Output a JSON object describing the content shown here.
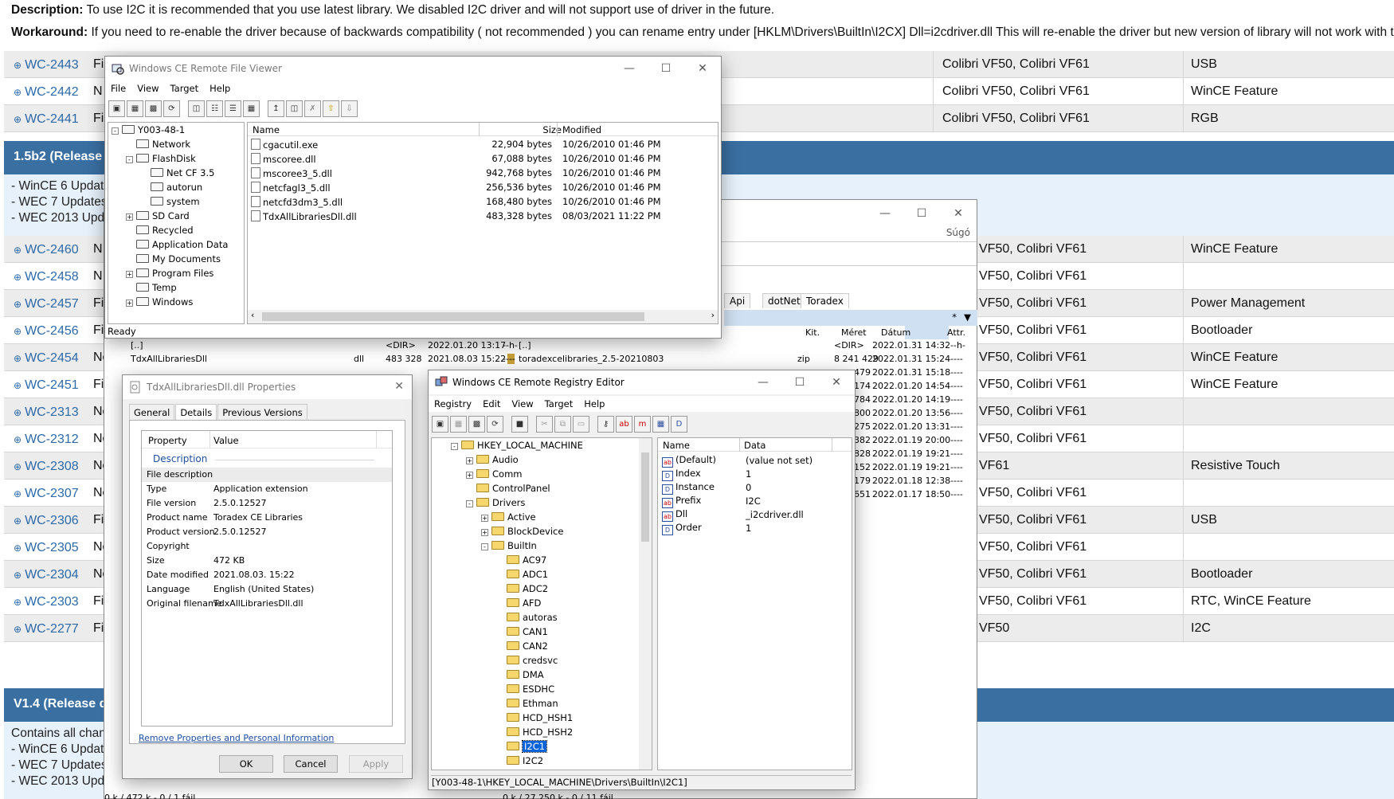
{
  "page": {
    "description_label": "Description:",
    "description_text": "To use I2C it is recommended that you use latest library. We disabled I2C driver and will not support use of driver in the future.",
    "workaround_label": "Workaround:",
    "workaround_text": "If you need to re-enable the driver because of backwards compatibility ( not recommended ) you can rename entry under [HKLM\\Drivers\\BuiltIn\\I2CX] Dll=i2cdriver.dll This will re-enable the driver but new version of library will not work with this.",
    "rows_top": [
      {
        "id": "WC-2443",
        "type": "Fi",
        "modules": "Colibri VF50, Colibri VF61",
        "component": "USB"
      },
      {
        "id": "WC-2442",
        "type": "N",
        "modules": "Colibri VF50, Colibri VF61",
        "component": "WinCE Feature"
      },
      {
        "id": "WC-2441",
        "type": "Fi",
        "modules": "Colibri VF50, Colibri VF61",
        "component": "RGB"
      }
    ],
    "release_1": "1.5b2 (Release",
    "notes_1": [
      "- WinCE 6 Update",
      "- WEC 7 Updates",
      "- WEC 2013 Upda"
    ],
    "rows_main": [
      {
        "id": "WC-2460",
        "type": "N",
        "modules": "VF50, Colibri VF61",
        "component": "WinCE Feature"
      },
      {
        "id": "WC-2458",
        "type": "N",
        "modules": "VF50, Colibri VF61",
        "component": ""
      },
      {
        "id": "WC-2457",
        "type": "Fi",
        "modules": "VF50, Colibri VF61",
        "component": "Power Management"
      },
      {
        "id": "WC-2456",
        "type": "Fix",
        "modules": "VF50, Colibri VF61",
        "component": "Bootloader"
      },
      {
        "id": "WC-2454",
        "type": "Nev",
        "modules": "VF50, Colibri VF61",
        "component": "WinCE Feature"
      },
      {
        "id": "WC-2451",
        "type": "Fix",
        "modules": "VF50, Colibri VF61",
        "component": "WinCE Feature"
      },
      {
        "id": "WC-2313",
        "type": "Nev",
        "modules": "VF50, Colibri VF61",
        "component": ""
      },
      {
        "id": "WC-2312",
        "type": "Nev",
        "modules": "VF50, Colibri VF61",
        "component": ""
      },
      {
        "id": "WC-2308",
        "type": "Nev",
        "modules": "VF61",
        "component": "Resistive Touch"
      },
      {
        "id": "WC-2307",
        "type": "Nev",
        "modules": "VF50, Colibri VF61",
        "component": ""
      },
      {
        "id": "WC-2306",
        "type": "Fix",
        "modules": "VF50, Colibri VF61",
        "component": "USB"
      },
      {
        "id": "WC-2305",
        "type": "Nev",
        "modules": "VF50, Colibri VF61",
        "component": ""
      },
      {
        "id": "WC-2304",
        "type": "Nev",
        "modules": "VF50, Colibri VF61",
        "component": "Bootloader"
      },
      {
        "id": "WC-2303",
        "type": "Fix",
        "modules": "VF50, Colibri VF61",
        "component": "RTC, WinCE Feature"
      },
      {
        "id": "WC-2277",
        "type": "Fix",
        "modules": "VF50",
        "component": "I2C"
      }
    ],
    "release_2": "V1.4 (Release d",
    "notes_2": [
      "Contains all chang",
      "- WinCE 6 Updates",
      "- WEC 7 Updates:",
      "- WEC 2013 Updat"
    ]
  },
  "file_viewer": {
    "title": "Windows CE Remote File Viewer",
    "menu": [
      "File",
      "View",
      "Target",
      "Help"
    ],
    "tree": [
      "Y003-48-1",
      "Network",
      "FlashDisk",
      "Net CF 3.5",
      "autorun",
      "system",
      "SD Card",
      "Recycled",
      "Application Data",
      "My Documents",
      "Program Files",
      "Temp",
      "Windows"
    ],
    "columns": [
      "Name",
      "Size",
      "Modified"
    ],
    "files": [
      {
        "name": "cgacutil.exe",
        "size": "22,904 bytes",
        "modified": "10/26/2010 01:46 PM"
      },
      {
        "name": "mscoree.dll",
        "size": "67,088 bytes",
        "modified": "10/26/2010 01:46 PM"
      },
      {
        "name": "mscoree3_5.dll",
        "size": "942,768 bytes",
        "modified": "10/26/2010 01:46 PM"
      },
      {
        "name": "netcfagl3_5.dll",
        "size": "256,536 bytes",
        "modified": "10/26/2010 01:46 PM"
      },
      {
        "name": "netcfd3dm3_5.dll",
        "size": "168,480 bytes",
        "modified": "10/26/2010 01:46 PM"
      },
      {
        "name": "TdxAllLibrariesDll.dll",
        "size": "483,328 bytes",
        "modified": "08/03/2021 11:22 PM"
      }
    ],
    "status": "Ready"
  },
  "commander": {
    "help": "Súgó",
    "tabs": [
      "Api",
      "dotNet",
      "Toradex"
    ],
    "tab_marker": "*",
    "right_cols": [
      "Kit.",
      "Méret",
      "Dátum",
      "Attr."
    ],
    "right_rows": [
      {
        "name": "[..]",
        "ext": "",
        "size": "<DIR>",
        "date": "2022.01.31 14:32",
        "attr": "--h-"
      },
      {
        "name": "toradexcelibraries_2.5-20210803",
        "ext": "zip",
        "size": "8 241 429",
        "date": "2022.01.31 15:24",
        "attr": "----"
      }
    ],
    "more_sizes": [
      "479",
      "174",
      "784",
      "800",
      "275",
      "382",
      "828",
      "152",
      "179",
      "651"
    ],
    "more_dates": [
      "2022.01.31 15:18",
      "2022.01.20 14:54",
      "2022.01.20 14:19",
      "2022.01.20 13:56",
      "2022.01.20 13:31",
      "2022.01.19 20:00",
      "2022.01.19 19:21",
      "2022.01.19 19:21",
      "2022.01.18 12:38",
      "2022.01.17 18:50"
    ],
    "left_rows": [
      {
        "name": "[..]",
        "ext": "",
        "size": "<DIR>",
        "date": "2022.01.20 13:17",
        "attr": "--h-"
      },
      {
        "name": "TdxAllLibrariesDll",
        "ext": "dll",
        "size": "483 328",
        "date": "2021.08.03 15:22",
        "attr": "----"
      }
    ],
    "status_left": "0 k / 472 k - 0 / 1 fájl",
    "status_right": "0 k / 27 250 k - 0 / 11 fájl"
  },
  "properties": {
    "title": "TdxAllLibrariesDll.dll Properties",
    "tabs": [
      "General",
      "Details",
      "Previous Versions"
    ],
    "col_property": "Property",
    "col_value": "Value",
    "section": "Description",
    "items": [
      {
        "k": "File description",
        "v": ""
      },
      {
        "k": "Type",
        "v": "Application extension"
      },
      {
        "k": "File version",
        "v": "2.5.0.12527"
      },
      {
        "k": "Product name",
        "v": "Toradex CE Libraries"
      },
      {
        "k": "Product version",
        "v": "2.5.0.12527"
      },
      {
        "k": "Copyright",
        "v": ""
      },
      {
        "k": "Size",
        "v": "472 KB"
      },
      {
        "k": "Date modified",
        "v": "2021.08.03. 15:22"
      },
      {
        "k": "Language",
        "v": "English (United States)"
      },
      {
        "k": "Original filename",
        "v": "TdxAllLibrariesDll.dll"
      }
    ],
    "link": "Remove Properties and Personal Information",
    "ok": "OK",
    "cancel": "Cancel",
    "apply": "Apply"
  },
  "registry": {
    "title": "Windows CE Remote Registry Editor",
    "menu": [
      "Registry",
      "Edit",
      "View",
      "Target",
      "Help"
    ],
    "tree": [
      {
        "label": "HKEY_LOCAL_MACHINE",
        "lvl": 0,
        "exp": "-"
      },
      {
        "label": "Audio",
        "lvl": 1,
        "exp": "+"
      },
      {
        "label": "Comm",
        "lvl": 1,
        "exp": "+"
      },
      {
        "label": "ControlPanel",
        "lvl": 1,
        "exp": ""
      },
      {
        "label": "Drivers",
        "lvl": 1,
        "exp": "-"
      },
      {
        "label": "Active",
        "lvl": 2,
        "exp": "+"
      },
      {
        "label": "BlockDevice",
        "lvl": 2,
        "exp": "+"
      },
      {
        "label": "BuiltIn",
        "lvl": 2,
        "exp": "-"
      },
      {
        "label": "AC97",
        "lvl": 3,
        "exp": ""
      },
      {
        "label": "ADC1",
        "lvl": 3,
        "exp": ""
      },
      {
        "label": "ADC2",
        "lvl": 3,
        "exp": ""
      },
      {
        "label": "AFD",
        "lvl": 3,
        "exp": ""
      },
      {
        "label": "autoras",
        "lvl": 3,
        "exp": ""
      },
      {
        "label": "CAN1",
        "lvl": 3,
        "exp": ""
      },
      {
        "label": "CAN2",
        "lvl": 3,
        "exp": ""
      },
      {
        "label": "credsvc",
        "lvl": 3,
        "exp": ""
      },
      {
        "label": "DMA",
        "lvl": 3,
        "exp": ""
      },
      {
        "label": "ESDHC",
        "lvl": 3,
        "exp": ""
      },
      {
        "label": "Ethman",
        "lvl": 3,
        "exp": ""
      },
      {
        "label": "HCD_HSH1",
        "lvl": 3,
        "exp": ""
      },
      {
        "label": "HCD_HSH2",
        "lvl": 3,
        "exp": ""
      },
      {
        "label": "I2C1",
        "lvl": 3,
        "exp": "",
        "sel": true
      },
      {
        "label": "I2C2",
        "lvl": 3,
        "exp": ""
      }
    ],
    "col_name": "Name",
    "col_data": "Data",
    "values": [
      {
        "type": "ab",
        "name": "(Default)",
        "data": "(value not set)"
      },
      {
        "type": "D",
        "name": "Index",
        "data": "1"
      },
      {
        "type": "D",
        "name": "Instance",
        "data": "0"
      },
      {
        "type": "ab",
        "name": "Prefix",
        "data": "I2C"
      },
      {
        "type": "ab",
        "name": "Dll",
        "data": "_i2cdriver.dll"
      },
      {
        "type": "D",
        "name": "Order",
        "data": "1"
      }
    ],
    "status": "[Y003-48-1\\HKEY_LOCAL_MACHINE\\Drivers\\BuiltIn\\I2C1]"
  },
  "colors": {
    "accent": "#3a6fa2",
    "link": "#2c6aa8",
    "notes_bg": "#e6f1fb",
    "selection": "#0a64d8"
  }
}
